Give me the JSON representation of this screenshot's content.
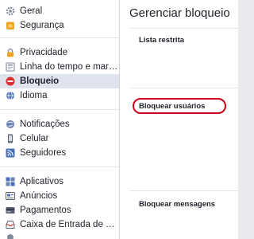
{
  "sidebar": {
    "groups": [
      [
        {
          "label": "Geral",
          "icon": "gear-icon"
        },
        {
          "label": "Segurança",
          "icon": "badge-icon"
        }
      ],
      [
        {
          "label": "Privacidade",
          "icon": "lock-icon"
        },
        {
          "label": "Linha do tempo e marcação",
          "icon": "timeline-icon"
        },
        {
          "label": "Bloqueio",
          "icon": "block-icon",
          "active": true
        },
        {
          "label": "Idioma",
          "icon": "globe-icon"
        }
      ],
      [
        {
          "label": "Notificações",
          "icon": "globe-notification-icon"
        },
        {
          "label": "Celular",
          "icon": "mobile-icon"
        },
        {
          "label": "Seguidores",
          "icon": "rss-icon"
        }
      ],
      [
        {
          "label": "Aplicativos",
          "icon": "apps-icon"
        },
        {
          "label": "Anúncios",
          "icon": "ads-icon"
        },
        {
          "label": "Pagamentos",
          "icon": "card-icon"
        },
        {
          "label": "Caixa de Entrada de Suporte",
          "icon": "inbox-icon"
        }
      ]
    ]
  },
  "main": {
    "title": "Gerenciar bloqueio",
    "sections": {
      "restricted": "Lista restrita",
      "block_users": "Bloquear usuários",
      "block_messages": "Bloquear mensagens"
    }
  },
  "colors": {
    "highlight_circle": "#d0021b",
    "active_bg": "#dfe3ee"
  }
}
